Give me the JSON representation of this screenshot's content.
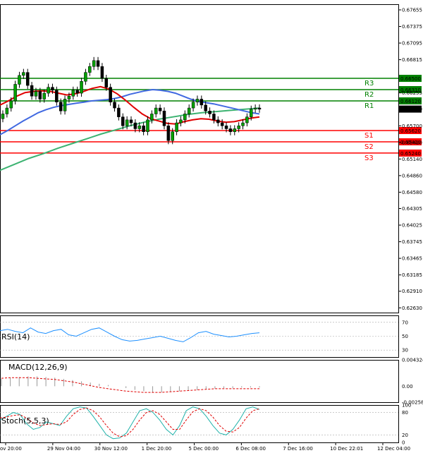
{
  "chart_data": {
    "type": "candlestick",
    "price_axis": {
      "ticks": [
        "0.67655",
        "0.67375",
        "0.67095",
        "0.66815",
        "0.66255",
        "0.65980",
        "0.65700",
        "0.65420",
        "0.65140",
        "0.64860",
        "0.64580",
        "0.64305",
        "0.64025",
        "0.63745",
        "0.63465",
        "0.63185",
        "0.62910",
        "0.62630"
      ],
      "range": [
        0.6255,
        0.6775
      ]
    },
    "time_axis": [
      "ov 20:00",
      "29 Nov 04:00",
      "30 Nov 12:00",
      "1 Dec 20:00",
      "5 Dec 00:00",
      "6 Dec 08:00",
      "7 Dec 16:00",
      "10 Dec 22:01",
      "12 Dec 04:00"
    ],
    "levels": [
      {
        "name": "R3",
        "value": 0.665,
        "price_label": "0.66500",
        "color": "#008000"
      },
      {
        "name": "R2",
        "value": 0.6631,
        "price_label": "0.66310",
        "color": "#008000"
      },
      {
        "name": "R1",
        "value": 0.6612,
        "price_label": "0.66120",
        "color": "#008000"
      },
      {
        "name": "S1",
        "value": 0.6562,
        "price_label": "0.65620",
        "color": "#ff0000"
      },
      {
        "name": "S2",
        "value": 0.6543,
        "price_label": "0.65430",
        "color": "#ff0000"
      },
      {
        "name": "S3",
        "value": 0.6524,
        "price_label": "0.65240",
        "color": "#ff0000"
      }
    ],
    "current_price": {
      "value": 0.65982,
      "label": "0.65982"
    },
    "candles_close": [
      0.659,
      0.66,
      0.6612,
      0.664,
      0.6655,
      0.666,
      0.6638,
      0.662,
      0.6628,
      0.6615,
      0.6625,
      0.6635,
      0.663,
      0.661,
      0.6595,
      0.6615,
      0.662,
      0.663,
      0.6625,
      0.6645,
      0.666,
      0.667,
      0.668,
      0.667,
      0.665,
      0.6635,
      0.661,
      0.66,
      0.6585,
      0.657,
      0.658,
      0.6575,
      0.6565,
      0.657,
      0.656,
      0.658,
      0.659,
      0.66,
      0.6595,
      0.657,
      0.6545,
      0.656,
      0.6575,
      0.658,
      0.659,
      0.66,
      0.661,
      0.6615,
      0.6605,
      0.6595,
      0.659,
      0.658,
      0.6575,
      0.657,
      0.6565,
      0.656,
      0.6565,
      0.657,
      0.6575,
      0.6585,
      0.6598,
      0.66,
      0.6598
    ],
    "ma_slow_blue": [
      0.6555,
      0.6562,
      0.657,
      0.6578,
      0.6585,
      0.6592,
      0.6597,
      0.6601,
      0.6604,
      0.6606,
      0.6608,
      0.661,
      0.6612,
      0.6613,
      0.6614,
      0.6616,
      0.6619,
      0.6623,
      0.6626,
      0.6629,
      0.6631,
      0.663,
      0.6628,
      0.6625,
      0.662,
      0.6615,
      0.6611,
      0.6609,
      0.6607,
      0.6604,
      0.6601,
      0.6598,
      0.6595,
      0.6592,
      0.659
    ],
    "ma_fast_red": [
      0.6605,
      0.6612,
      0.662,
      0.6626,
      0.6628,
      0.6629,
      0.6628,
      0.6625,
      0.6622,
      0.6624,
      0.6628,
      0.6633,
      0.6636,
      0.6632,
      0.6624,
      0.6613,
      0.6601,
      0.659,
      0.6582,
      0.6578,
      0.6574,
      0.6573,
      0.6577,
      0.658,
      0.6582,
      0.6581,
      0.6578,
      0.6576,
      0.6577,
      0.658,
      0.6583,
      0.6585
    ],
    "ma_long_green": [
      0.6495,
      0.6505,
      0.6515,
      0.6523,
      0.6532,
      0.654,
      0.6548,
      0.6556,
      0.6563,
      0.657,
      0.6576,
      0.6581,
      0.6585,
      0.6589,
      0.6592,
      0.6594,
      0.6596,
      0.6598,
      0.66
    ],
    "rsi": {
      "title": "RSI(14)",
      "ticks": [
        "70",
        "50",
        "30"
      ],
      "values": [
        58,
        60,
        57,
        55,
        62,
        56,
        54,
        58,
        60,
        52,
        50,
        55,
        60,
        62,
        56,
        50,
        45,
        43,
        44,
        46,
        48,
        50,
        47,
        44,
        42,
        48,
        55,
        57,
        53,
        51,
        49,
        50,
        52,
        54,
        55
      ]
    },
    "macd": {
      "title": "MACD(12,26,9)",
      "ticks": [
        "0.004324",
        "0.00",
        "-0.002586"
      ],
      "values": [
        0.0012,
        0.0014,
        0.0015,
        0.0016,
        0.0016,
        0.0015,
        0.0014,
        0.0012,
        0.001,
        0.0008,
        0.0006,
        0.0004,
        0.0002,
        0.0,
        -0.0003,
        -0.0006,
        -0.0008,
        -0.001,
        -0.001,
        -0.0009,
        -0.0008,
        -0.0007,
        -0.0006,
        -0.0005,
        -0.0004,
        -0.0003,
        -0.0003,
        -0.0002,
        -0.0002,
        -0.0002
      ],
      "signal": [
        0.0013,
        0.0014,
        0.0014,
        0.0014,
        0.0013,
        0.0012,
        0.0011,
        0.0009,
        0.0007,
        0.0004,
        0.0001,
        -0.0002,
        -0.0004,
        -0.0006,
        -0.0008,
        -0.0009,
        -0.001,
        -0.001,
        -0.001,
        -0.0009,
        -0.0008,
        -0.0007,
        -0.0006,
        -0.0005,
        -0.0004,
        -0.0004,
        -0.0004,
        -0.0004,
        -0.0004,
        -0.0004
      ]
    },
    "stoch": {
      "title": "Stoch(5,5,3)",
      "ticks": [
        "100",
        "80",
        "20",
        "0"
      ],
      "k": [
        60,
        70,
        80,
        75,
        50,
        35,
        40,
        55,
        50,
        45,
        70,
        90,
        95,
        92,
        70,
        45,
        20,
        10,
        12,
        25,
        55,
        85,
        90,
        80,
        60,
        35,
        20,
        45,
        85,
        95,
        90,
        70,
        45,
        25,
        20,
        35,
        60,
        90,
        95,
        88
      ],
      "d": [
        65,
        68,
        72,
        74,
        65,
        52,
        45,
        48,
        50,
        48,
        55,
        75,
        88,
        92,
        85,
        68,
        45,
        25,
        15,
        18,
        35,
        60,
        80,
        85,
        75,
        55,
        35,
        35,
        60,
        82,
        90,
        85,
        68,
        45,
        30,
        28,
        40,
        65,
        85,
        90
      ]
    }
  }
}
